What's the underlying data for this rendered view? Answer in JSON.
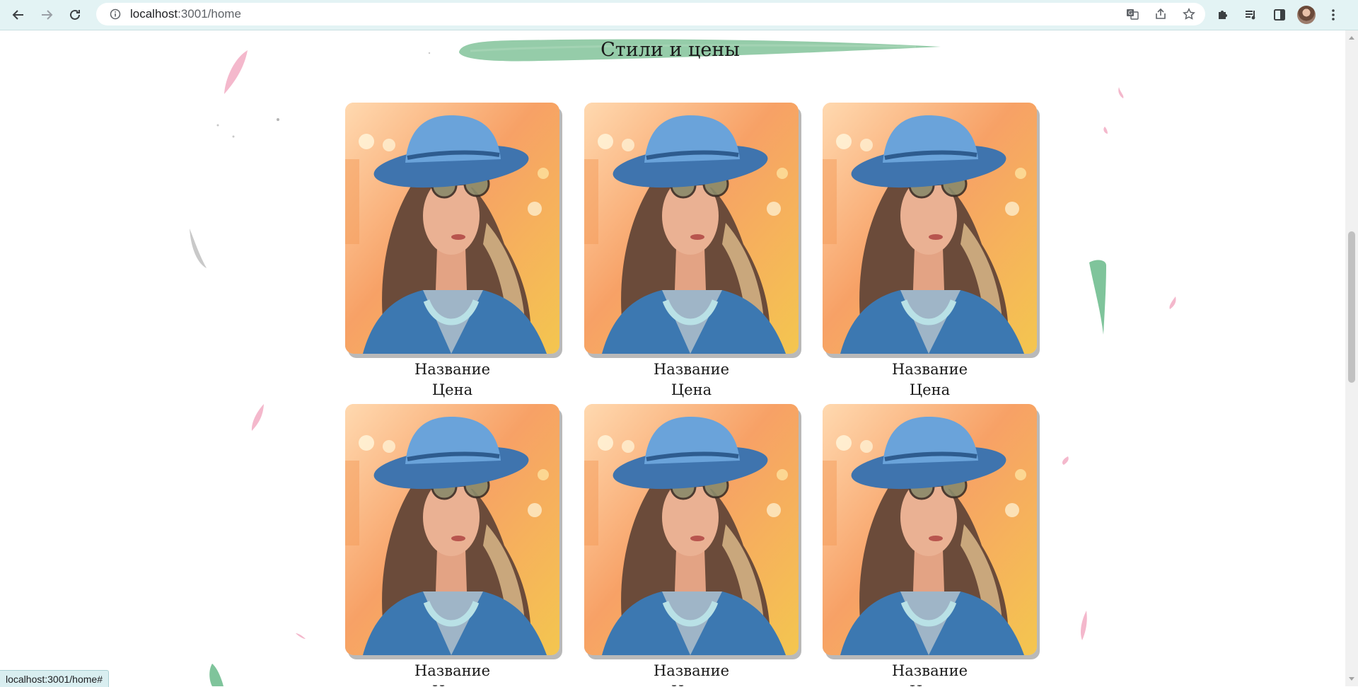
{
  "browser": {
    "url_host": "localhost",
    "url_path": ":3001/home",
    "status_url": "localhost:3001/home#",
    "icons": {
      "back": "arrow-left-icon",
      "forward": "arrow-right-icon",
      "reload": "reload-icon",
      "site_info": "info-icon",
      "translate": "translate-icon",
      "share": "share-icon",
      "bookmark": "star-icon",
      "extensions": "puzzle-icon",
      "media": "media-queue-icon",
      "side_panel": "side-panel-icon",
      "profile": "avatar",
      "menu": "kebab-menu-icon"
    }
  },
  "section": {
    "title": "Стили и цены",
    "banner_color": "#8fc9a4"
  },
  "cards": [
    {
      "name": "Название",
      "price": "Цена"
    },
    {
      "name": "Название",
      "price": "Цена"
    },
    {
      "name": "Название",
      "price": "Цена"
    },
    {
      "name": "Название",
      "price": "Цена"
    },
    {
      "name": "Название",
      "price": "Цена"
    },
    {
      "name": "Название",
      "price": "Цена"
    }
  ],
  "colors": {
    "chrome_bg": "#e3f3f4",
    "petal_pink": "#f4b8cc",
    "petal_green": "#7fc49b",
    "petal_gray": "#bcbcbc"
  }
}
